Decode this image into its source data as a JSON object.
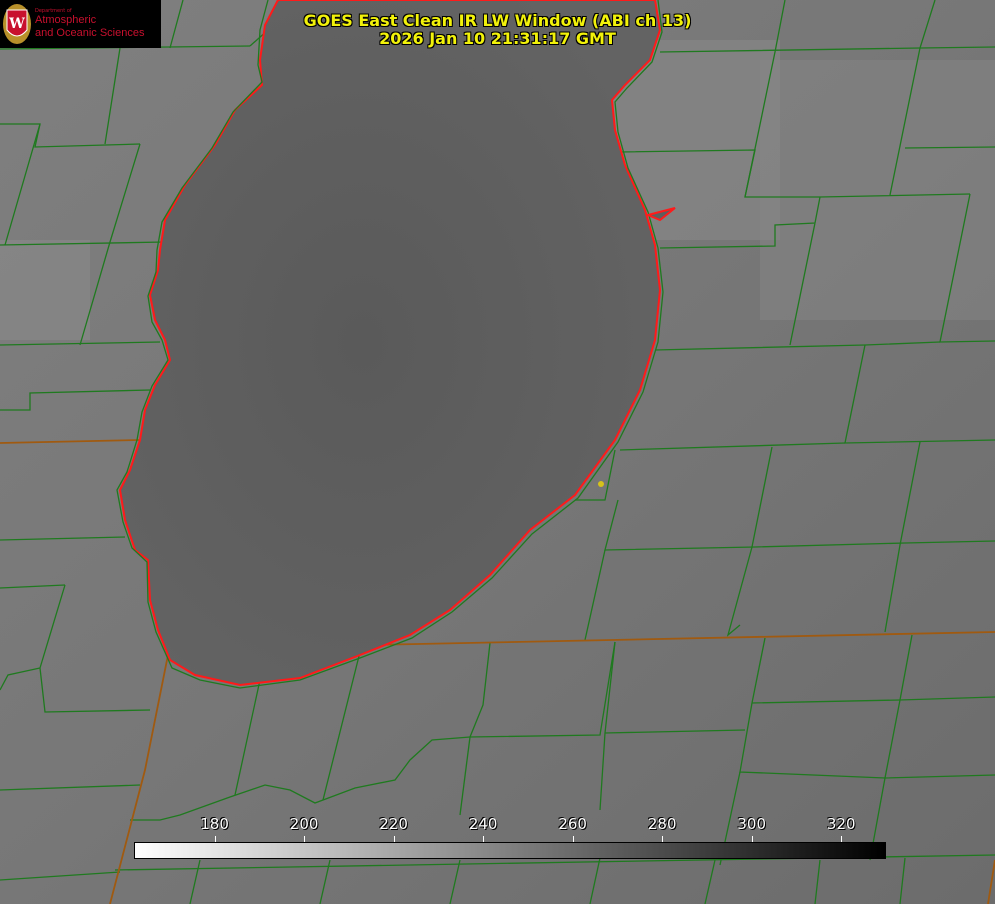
{
  "title": {
    "line1": "GOES East Clean IR LW Window (ABI ch 13)",
    "line2": "2026 Jan 10 21:31:17 GMT"
  },
  "logo": {
    "department": "Department of",
    "line1": "Atmospheric",
    "line2": "and Oceanic Sciences",
    "emblem": "uw-crest-icon"
  },
  "colorbar": {
    "min": 162,
    "max": 330,
    "ticks": [
      "180",
      "200",
      "220",
      "240",
      "260",
      "280",
      "300",
      "320"
    ],
    "color_min": "#ffffff",
    "color_max": "#000000"
  },
  "colors": {
    "text": "#f2f20a",
    "county_lines": "#1f7a1f",
    "state_lines": "#a05a10",
    "lake_outline": "#ff1a1a",
    "marker": "#d6c21a",
    "land": "#7d7d7d",
    "lake": "#5e5e5e"
  }
}
